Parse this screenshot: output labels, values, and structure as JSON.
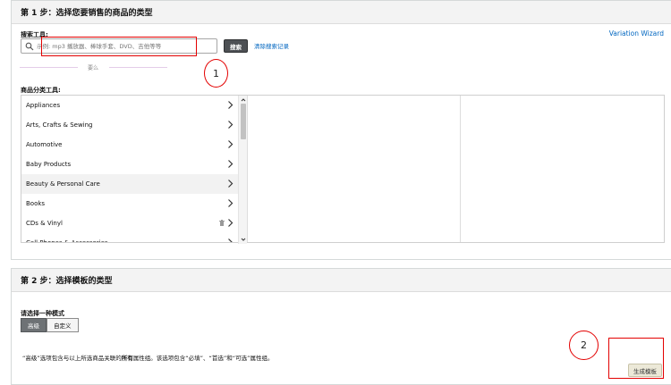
{
  "step1": {
    "title": "第 1 步：选择您要销售的商品的类型",
    "variation_wizard": "Variation Wizard",
    "search_label": "搜索工具:",
    "search_placeholder": "示例: mp3 播放器、棒球手套、DVD、吉他等等",
    "search_button": "搜索",
    "clear_history": "清除搜索记录",
    "or_text": "要么",
    "browse_label": "商品分类工具:",
    "categories": [
      {
        "label": "Appliances"
      },
      {
        "label": "Arts, Crafts & Sewing"
      },
      {
        "label": "Automotive"
      },
      {
        "label": "Baby Products"
      },
      {
        "label": "Beauty & Personal Care"
      },
      {
        "label": "Books"
      },
      {
        "label": "CDs & Vinyl"
      },
      {
        "label": "Cell Phones & Accessories"
      }
    ],
    "highlighted_index": 4
  },
  "step2": {
    "title": "第 2 步：选择模板的类型",
    "mode_label": "请选择一种模式",
    "tabs": [
      {
        "label": "高级",
        "active": true
      },
      {
        "label": "自定义",
        "active": false
      }
    ],
    "description_parts": {
      "pre": "“高级”选项包含与以上所选商品关联的",
      "bold": "所有",
      "post": "属性组。该选项包含“必填”、“首选”和“可选”属性组。"
    },
    "generate_button": "生成模板"
  },
  "annotations": {
    "marker_1": "1",
    "marker_2": "2",
    "color": "#e30000"
  },
  "colors": {
    "link": "#0066c0",
    "search_button_bg": "#4d5054",
    "active_tab_bg": "#6e7275"
  }
}
